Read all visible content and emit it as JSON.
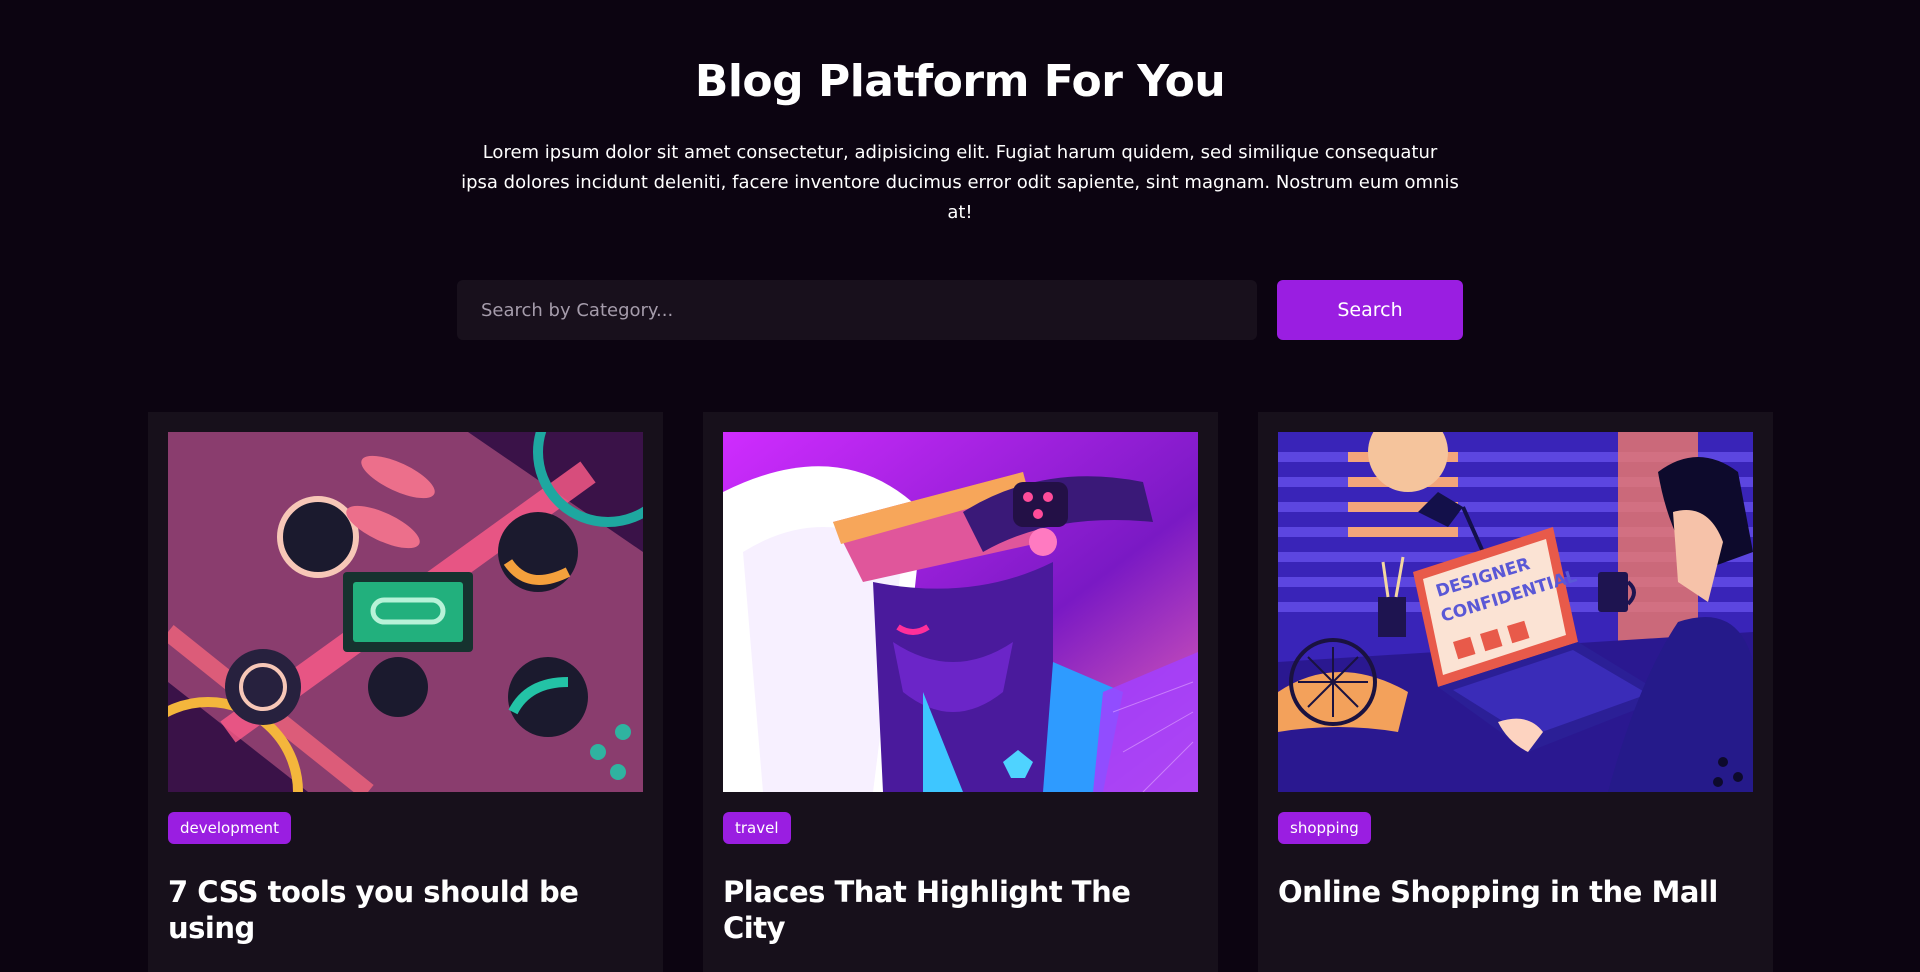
{
  "hero": {
    "title": "Blog Platform For You",
    "description_line1": "Lorem ipsum dolor sit amet consectetur, adipisicing elit. Fugiat harum quidem, sed similique consequatur",
    "description_line2": "ipsa dolores incidunt deleniti, facere inventore ducimus error odit sapiente, sint magnam. Nostrum eum omnis at!"
  },
  "search": {
    "placeholder": "Search by Category...",
    "value": "",
    "button_label": "Search"
  },
  "colors": {
    "background": "#0c0411",
    "card": "#17101b",
    "accent": "#9a1ee1"
  },
  "posts": [
    {
      "category": "development",
      "title": "7 CSS tools you should be using",
      "image": "people-around-table-illustration"
    },
    {
      "category": "travel",
      "title": "Places That Highlight The City",
      "image": "vr-headset-woman-illustration"
    },
    {
      "category": "shopping",
      "title": "Online Shopping in the Mall",
      "image": "designer-laptop-desk-illustration"
    }
  ],
  "illustration_text": {
    "laptop_screen": "DESIGNER CONFIDENTIAL"
  }
}
